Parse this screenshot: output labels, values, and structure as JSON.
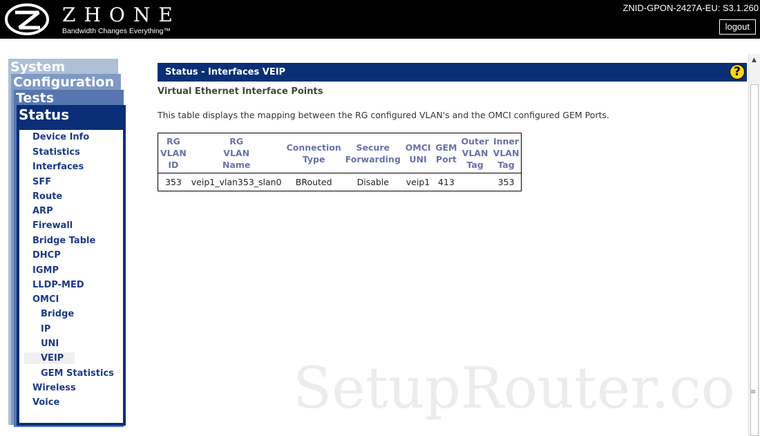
{
  "header": {
    "brand": "ZHONE",
    "tagline": "Bandwidth Changes Everything™",
    "device_id": "ZNID-GPON-2427A-EU: S3.1.260",
    "logout_label": "logout"
  },
  "nav": {
    "tabs": [
      "System",
      "Configuration",
      "Tests",
      "Status"
    ],
    "items": [
      {
        "label": "Device Info"
      },
      {
        "label": "Statistics"
      },
      {
        "label": "Interfaces"
      },
      {
        "label": "SFF"
      },
      {
        "label": "Route"
      },
      {
        "label": "ARP"
      },
      {
        "label": "Firewall"
      },
      {
        "label": "Bridge Table"
      },
      {
        "label": "DHCP"
      },
      {
        "label": "IGMP"
      },
      {
        "label": "LLDP-MED"
      },
      {
        "label": "OMCI"
      },
      {
        "label": "Bridge"
      },
      {
        "label": "IP"
      },
      {
        "label": "UNI"
      },
      {
        "label": "VEIP"
      },
      {
        "label": "GEM Statistics"
      },
      {
        "label": "Wireless"
      },
      {
        "label": "Voice"
      }
    ]
  },
  "content": {
    "title": "Status - Interfaces VEIP",
    "help_label": "?",
    "subtitle": "Virtual Ethernet Interface Points",
    "description": "This table displays the mapping between the RG configured VLAN's and the OMCI configured GEM Ports.",
    "table": {
      "headers": [
        [
          "RG",
          "VLAN",
          "ID"
        ],
        [
          "RG",
          "VLAN",
          "Name"
        ],
        [
          "Connection",
          "Type"
        ],
        [
          "Secure",
          "Forwarding"
        ],
        [
          "OMCI",
          "UNI"
        ],
        [
          "GEM",
          "Port"
        ],
        [
          "Outer",
          "VLAN",
          "Tag"
        ],
        [
          "Inner",
          "VLAN",
          "Tag"
        ]
      ],
      "rows": [
        [
          "353",
          "veip1_vlan353_slan0",
          "BRouted",
          "Disable",
          "veip1",
          "413",
          "",
          "353"
        ]
      ]
    }
  },
  "watermark": "SetupRouter.co",
  "colors": {
    "header_bg": "#000000",
    "nav_dark": "#0a2f78",
    "menu_text": "#1c3a8a",
    "table_header_text": "#6673aa",
    "help_icon": "#f7d417"
  }
}
